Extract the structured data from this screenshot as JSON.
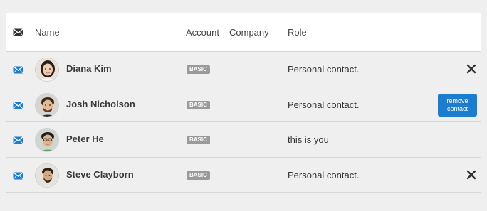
{
  "header": {
    "icon": "envelope-icon",
    "columns": [
      "Name",
      "Account",
      "Company",
      "Role"
    ]
  },
  "contacts": [
    {
      "name": "Diana Kim",
      "account": "BASIC",
      "company": "",
      "role": "Personal contact.",
      "action": "close-icon",
      "action_label": "✕"
    },
    {
      "name": "Josh Nicholson",
      "account": "BASIC",
      "company": "",
      "role": "Personal contact.",
      "action": "remove-button",
      "action_label": "remove contact"
    },
    {
      "name": "Peter He",
      "account": "BASIC",
      "company": "",
      "role": "this is you",
      "action": "none",
      "action_label": ""
    },
    {
      "name": "Steve Clayborn",
      "account": "BASIC",
      "company": "",
      "role": "Personal contact.",
      "action": "close-icon",
      "action_label": "✕"
    }
  ],
  "colors": {
    "envelope": "#1a7dd0",
    "header_envelope": "#333333",
    "badge": "#9a9a9a",
    "remove_button": "#1a7dd0",
    "background": "#efefef"
  }
}
